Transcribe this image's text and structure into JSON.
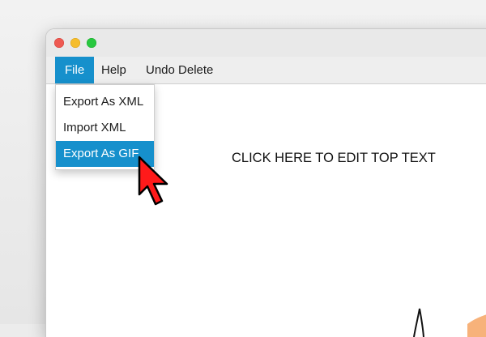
{
  "window": {
    "controls": [
      "close",
      "minimize",
      "maximize"
    ]
  },
  "menubar": {
    "items": [
      {
        "label": "File",
        "selected": true
      },
      {
        "label": "Help",
        "selected": false
      },
      {
        "label": "Undo Delete",
        "selected": false
      }
    ]
  },
  "file_menu": {
    "items": [
      {
        "label": "Export As XML",
        "highlighted": false
      },
      {
        "label": "Import XML",
        "highlighted": false
      },
      {
        "label": "Export As GIF",
        "highlighted": true
      }
    ]
  },
  "canvas": {
    "top_text": "CLICK HERE TO EDIT TOP TEXT"
  },
  "colors": {
    "accent": "#1690cc",
    "cursor_fill": "#ff1a1a",
    "drawing_fill": "#f7b27a"
  },
  "icons": [
    "close-icon",
    "minimize-icon",
    "maximize-icon",
    "pointer-cursor-icon"
  ]
}
